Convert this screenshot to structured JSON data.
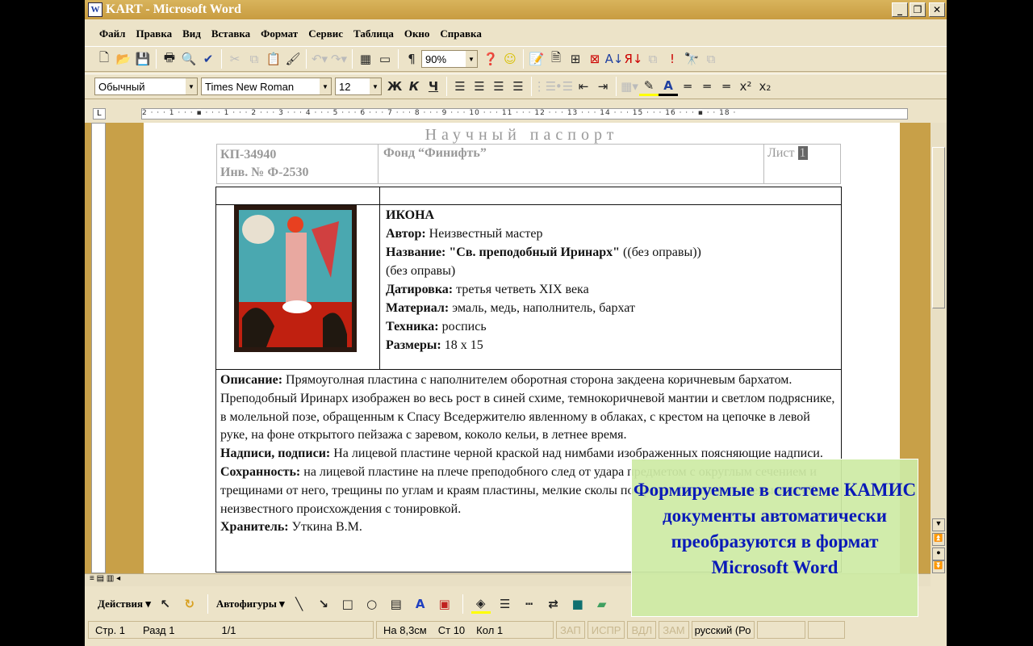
{
  "window": {
    "title": "KART - Microsoft Word",
    "app_icon": "W"
  },
  "menu": [
    "Файл",
    "Правка",
    "Вид",
    "Вставка",
    "Формат",
    "Сервис",
    "Таблица",
    "Окно",
    "Справка"
  ],
  "toolbar": {
    "zoom": "90%"
  },
  "formatting": {
    "style": "Обычный",
    "font": "Times New Roman",
    "size": "12",
    "bold": "Ж",
    "italic": "К",
    "underline": "Ч"
  },
  "ruler": "2 · · · 1 · · · ▪ · · · 1 · · · 2 · · · 3 · · · 4 · · · 5 · · · 6 · · · 7 · · · 8 · · · 9 · · · 10 · · · 11 · · · 12 · · · 13 · · · 14 · · · 15 · · · 16 · · · ▪ · · 18 ·",
  "document": {
    "page_heading": "Научный паспорт",
    "header": {
      "kp": "КП-34940",
      "inv": "Инв. № Ф-2530",
      "fund": "Фонд “Финифть”",
      "sheet_label": "Лист",
      "sheet_num": "1"
    },
    "item": {
      "type": "ИКОНА",
      "author_label": "Автор:",
      "author": "Неизвестный мастер",
      "name_label": "Название:",
      "name": "\"Св. преподобный Иринарх\"",
      "name_extra": "((без оправы))",
      "name_extra2": "(без оправы)",
      "date_label": "Датировка:",
      "date": "третья четветь XIX века",
      "material_label": "Материал:",
      "material": "эмаль, медь, наполнитель, бархат",
      "technique_label": "Техника:",
      "technique": "роспись",
      "size_label": "Размеры:",
      "size": "18 x 15"
    },
    "description_label": "Описание:",
    "description": "Прямоуголная пластина с наполнителем оборотная сторона закдеена коричневым бархатом. Преподобный Иринарх изображен во весь рост в синей схиме, темнокоричневой мантии и светлом подряснике, в молельной позе, обращенным к Спасу Вседержителю явленному в облаках, с крестом на цепочке в левой руке, на фоне открытого пейзажа с заревом, коколо кельи, в летнее время.",
    "inscriptions_label": "Надписи, подписи:",
    "inscriptions": "На лицевой пластине черной краской над нимбами изображенных поясняющие надписи.",
    "condition_label": "Сохранность:",
    "condition": "на лицевой пластине на плече преподобного след от удара предметом с округлым сечением и трещинами от него, трещины по углам и краям пластины, мелкие сколы по крачм. Сколы заполнены массой неизвестного происхождения с тонировкой.",
    "keeper_label": "Хранитель:",
    "keeper": "Уткина В.М."
  },
  "drawing": {
    "actions": "Действия ▾",
    "autoshapes": "Автофигуры ▾"
  },
  "status": {
    "page": "Стр. 1",
    "section": "Разд 1",
    "pages": "1/1",
    "at": "На 8,3см",
    "line": "Ст 10",
    "col": "Кол 1",
    "rec": "ЗАП",
    "trk": "ИСПР",
    "ext": "ВДЛ",
    "ovr": "ЗАМ",
    "lang": "русский (Ро"
  },
  "overlay": {
    "text": "Формируемые в системе КАМИС документы автоматически преобразуются в формат Microsoft Word",
    "color": "#0a1ab8"
  }
}
